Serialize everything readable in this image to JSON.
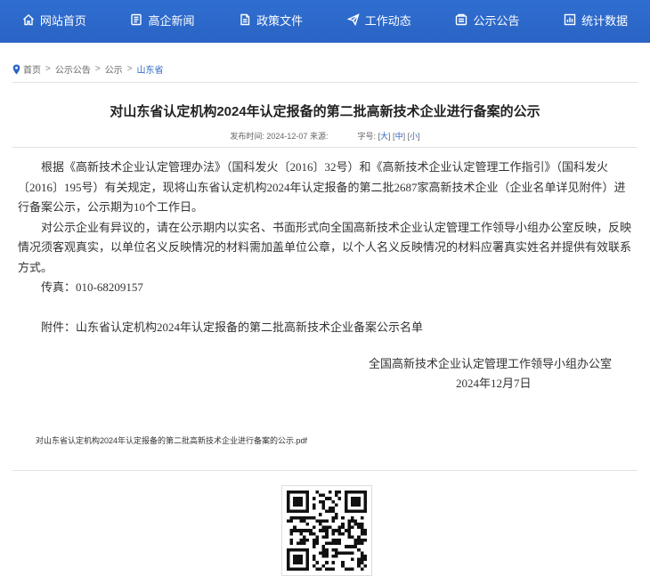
{
  "nav": [
    {
      "icon": "home-icon",
      "label": "网站首页"
    },
    {
      "icon": "news-icon",
      "label": "高企新闻"
    },
    {
      "icon": "document-icon",
      "label": "政策文件"
    },
    {
      "icon": "send-icon",
      "label": "工作动态"
    },
    {
      "icon": "notice-icon",
      "label": "公示公告"
    },
    {
      "icon": "chart-icon",
      "label": "统计数据"
    }
  ],
  "breadcrumb": {
    "items": [
      "首页",
      "公示公告",
      "公示"
    ],
    "current": "山东省",
    "separator": ">"
  },
  "article": {
    "title": "对山东省认定机构2024年认定报备的第二批高新技术企业进行备案的公示",
    "meta": {
      "publish_label": "发布时间:",
      "publish_date": "2024-12-07",
      "source_label": "来源:",
      "source": "",
      "fontsize_label": "字号:",
      "sizes": [
        "大",
        "中",
        "小"
      ]
    },
    "paragraphs": [
      "根据《高新技术企业认定管理办法》（国科发火〔2016〕32号）和《高新技术企业认定管理工作指引》（国科发火〔2016〕195号）有关规定，现将山东省认定机构2024年认定报备的第二批2687家高新技术企业（企业名单详见附件）进行备案公示，公示期为10个工作日。",
      "对公示企业有异议的，请在公示期内以实名、书面形式向全国高新技术企业认定管理工作领导小组办公室反映，反映情况须客观真实，以单位名义反映情况的材料需加盖单位公章，以个人名义反映情况的材料应署真实姓名并提供有效联系方式。"
    ],
    "fax": "传真：010-68209157",
    "attachment": "附件：山东省认定机构2024年认定报备的第二批高新技术企业备案公示名单",
    "signature_org": "全国高新技术企业认定管理工作领导小组办公室",
    "signature_date": "2024年12月7日"
  },
  "pdf_link": "对山东省认定机构2024年认定报备的第二批高新技术企业进行备案的公示.pdf",
  "colors": {
    "nav_bg": "#2a64c4",
    "link": "#2a64c4"
  }
}
